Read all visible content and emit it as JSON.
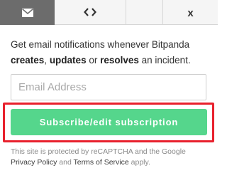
{
  "tabs": {
    "email_icon": "envelope-icon",
    "embed_icon": "code-icon",
    "embed_glyph": "<>",
    "close_label": "x"
  },
  "intro": {
    "lead": "Get email notifications whenever Bitpanda ",
    "word_creates": "creates",
    "sep1": ", ",
    "word_updates": "updates",
    "sep2": " or ",
    "word_resolves": "resolves",
    "tail": " an incident."
  },
  "form": {
    "email_placeholder": "Email Address",
    "email_value": "",
    "subscribe_label": "Subscribe/edit subscription"
  },
  "recaptcha": {
    "text_lead": "This site is protected by reCAPTCHA and the Google ",
    "privacy_link": "Privacy Policy",
    "and": " and ",
    "terms_link": "Terms of Service",
    "text_tail": " apply."
  },
  "colors": {
    "active_tab_bg": "#6c6c6c",
    "inactive_tab_bg": "#f5f5f5",
    "subscribe_button": "#55d68c",
    "highlight_border": "#e8212d"
  }
}
